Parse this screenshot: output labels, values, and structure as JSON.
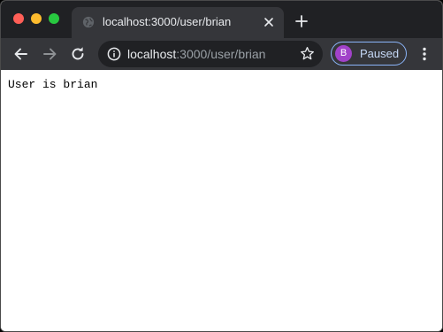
{
  "browser": {
    "tab": {
      "title": "localhost:3000/user/brian"
    },
    "address_bar": {
      "host": "localhost",
      "path": ":3000/user/brian"
    },
    "profile": {
      "initial": "B",
      "status": "Paused",
      "avatar_color": "#a142c9"
    },
    "icons": {
      "back": "arrow-left-icon",
      "forward": "arrow-right-icon",
      "reload": "reload-icon",
      "info": "info-icon",
      "bookmark": "star-icon",
      "menu": "kebab-menu-icon",
      "new_tab": "plus-icon",
      "tab_close": "close-icon",
      "favicon": "globe-icon"
    },
    "colors": {
      "close": "#ff5f57",
      "minimize": "#febc2e",
      "maximize": "#28c840",
      "profile_border": "#8ab4f8"
    }
  },
  "page": {
    "text": "User is brian"
  }
}
